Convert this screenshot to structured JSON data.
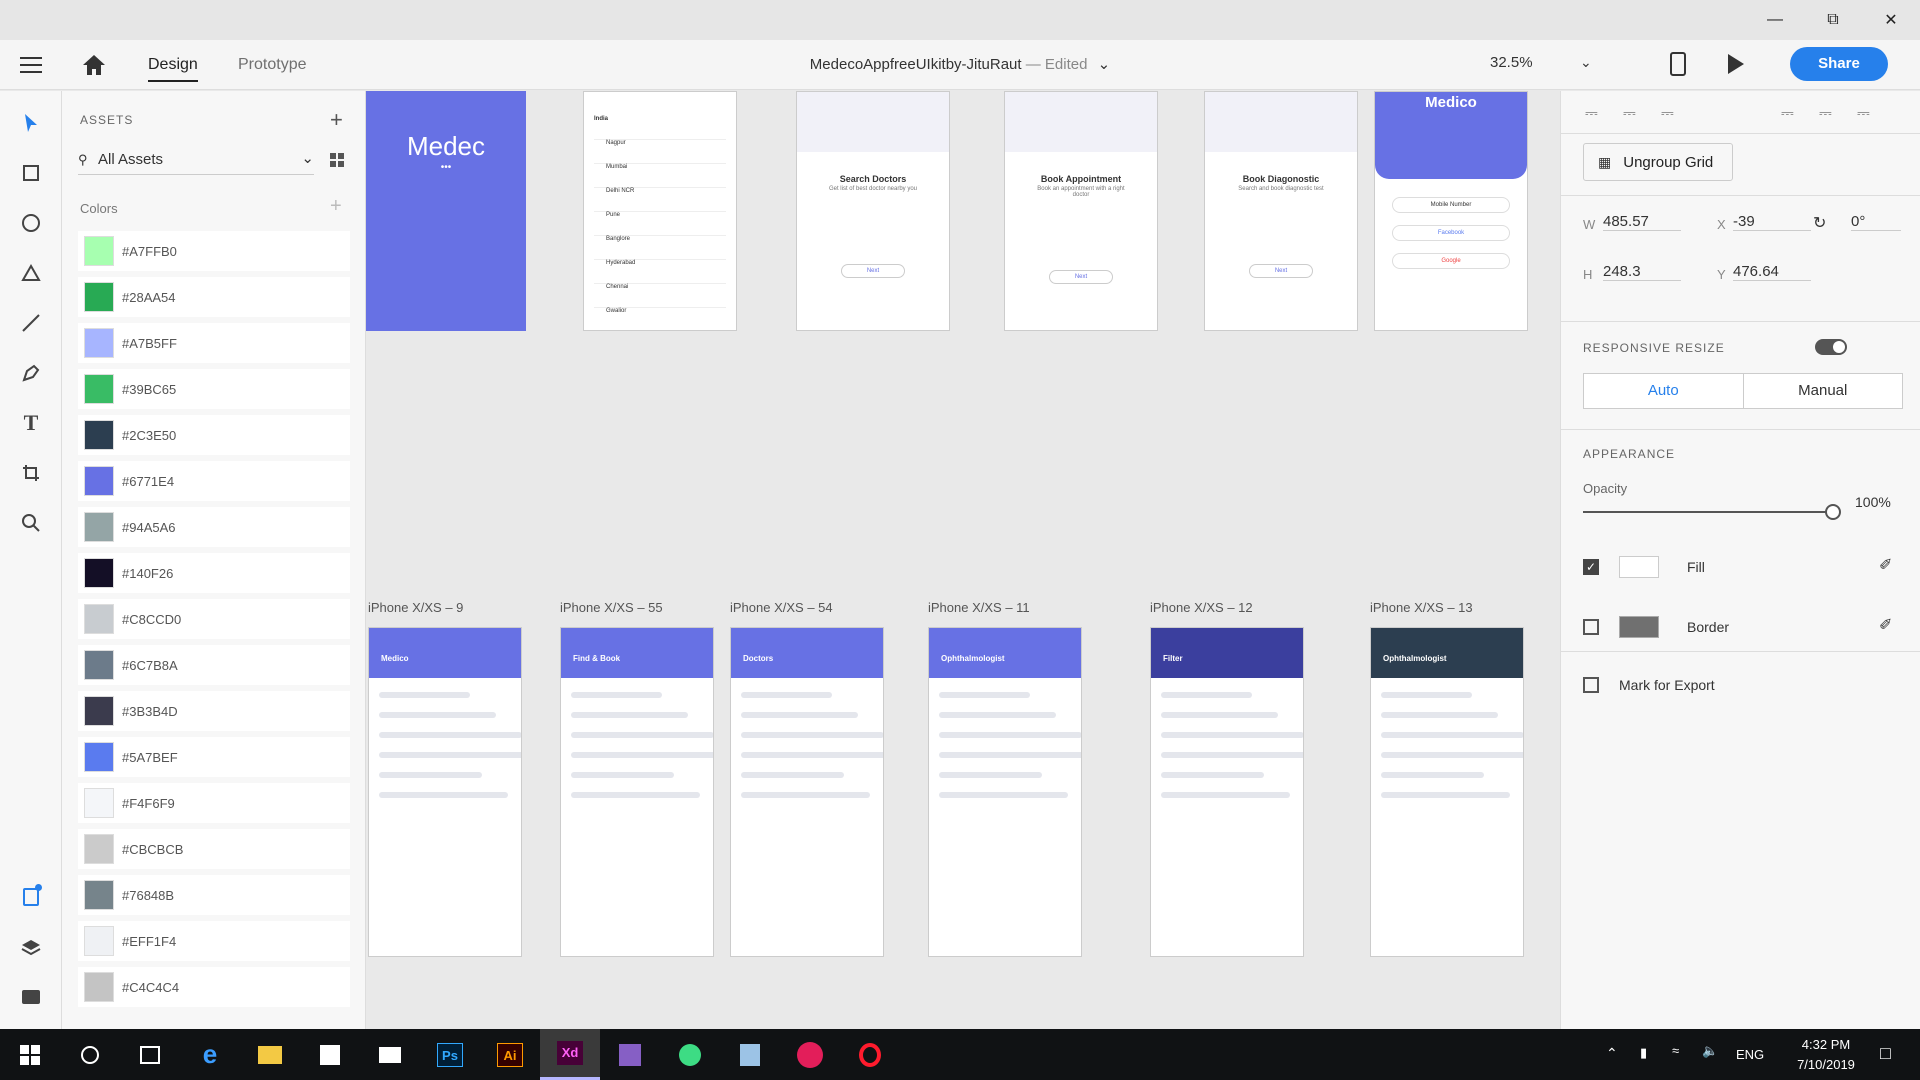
{
  "app": {
    "document_name": "MedecoAppfreeUIkitby-JituRaut",
    "status": "Edited",
    "zoom": "32.5%",
    "share_label": "Share"
  },
  "tabs": {
    "design": "Design",
    "prototype": "Prototype"
  },
  "assets": {
    "title": "ASSETS",
    "filter": "All Assets",
    "colors_title": "Colors",
    "colors": [
      {
        "hex": "#A7FFB0"
      },
      {
        "hex": "#28AA54"
      },
      {
        "hex": "#A7B5FF"
      },
      {
        "hex": "#39BC65"
      },
      {
        "hex": "#2C3E50"
      },
      {
        "hex": "#6771E4"
      },
      {
        "hex": "#94A5A6"
      },
      {
        "hex": "#140F26"
      },
      {
        "hex": "#C8CCD0"
      },
      {
        "hex": "#6C7B8A"
      },
      {
        "hex": "#3B3B4D"
      },
      {
        "hex": "#5A7BEF"
      },
      {
        "hex": "#F4F6F9"
      },
      {
        "hex": "#CBCBCB"
      },
      {
        "hex": "#76848B"
      },
      {
        "hex": "#EFF1F4"
      },
      {
        "hex": "#C4C4C4"
      }
    ]
  },
  "canvas": {
    "top_row": {
      "splash_text": "Medec",
      "onboard": [
        {
          "title": "Search Doctors",
          "sub": "Get list of best doctor nearby you",
          "btn": "Next"
        },
        {
          "title": "Book Appointment",
          "sub": "Book an appointment with a right doctor",
          "btn": "Next"
        },
        {
          "title": "Book Diagonostic",
          "sub": "Search and book diagnostic test",
          "btn": "Next"
        }
      ],
      "city_list": [
        "India",
        "Nagpur",
        "Mumbai",
        "Delhi NCR",
        "Pune",
        "Banglore",
        "Hyderabad",
        "Chennai",
        "Gwalior"
      ],
      "login": {
        "brand": "Medico",
        "b1": "Mobile Number",
        "b2": "Facebook",
        "b3": "Google"
      }
    },
    "artboards": [
      {
        "name": "iPhone X/XS – 9",
        "header": "Medico"
      },
      {
        "name": "iPhone X/XS – 55",
        "header": "Find & Book"
      },
      {
        "name": "iPhone X/XS – 54",
        "header": "Doctors"
      },
      {
        "name": "iPhone X/XS – 11",
        "header": "Ophthalmologist"
      },
      {
        "name": "iPhone X/XS – 12",
        "header": "Filter"
      },
      {
        "name": "iPhone X/XS – 13",
        "header": "Ophthalmologist"
      }
    ]
  },
  "properties": {
    "ungroup": "Ungroup Grid",
    "w_label": "W",
    "w": "485.57",
    "h_label": "H",
    "h": "248.3",
    "x_label": "X",
    "x": "-39",
    "y_label": "Y",
    "y": "476.64",
    "rotation": "0°",
    "responsive_title": "RESPONSIVE RESIZE",
    "auto": "Auto",
    "manual": "Manual",
    "appearance_title": "APPEARANCE",
    "opacity_label": "Opacity",
    "opacity": "100%",
    "fill_label": "Fill",
    "border_label": "Border",
    "export_label": "Mark for Export"
  },
  "taskbar": {
    "lang": "ENG",
    "time": "4:32 PM",
    "date": "7/10/2019"
  }
}
